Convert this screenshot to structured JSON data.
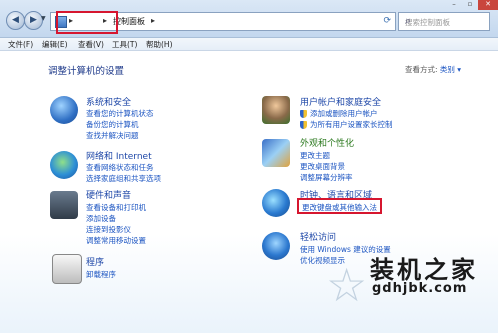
{
  "address": {
    "crumb": "控制面板",
    "search_placeholder": "搜索控制面板"
  },
  "menu": [
    "文件(F)",
    "编辑(E)",
    "查看(V)",
    "工具(T)",
    "帮助(H)"
  ],
  "page": {
    "title": "调整计算机的设置",
    "view_by_label": "查看方式:",
    "view_by_value": "类别 ▾"
  },
  "categories": {
    "system": {
      "title": "系统和安全",
      "links": [
        "查看您的计算机状态",
        "备份您的计算机",
        "查找并解决问题"
      ]
    },
    "network": {
      "title": "网络和 Internet",
      "links": [
        "查看网络状态和任务",
        "选择家庭组和共享选项"
      ]
    },
    "hardware": {
      "title": "硬件和声音",
      "links": [
        "查看设备和打印机",
        "添加设备",
        "连接到投影仪",
        "调整常用移动设置"
      ]
    },
    "programs": {
      "title": "程序",
      "links": [
        "卸载程序"
      ]
    },
    "users": {
      "title": "用户帐户和家庭安全",
      "links": [
        "添加或删除用户帐户",
        "为所有用户设置家长控制"
      ]
    },
    "appearance": {
      "title": "外观和个性化",
      "links": [
        "更改主题",
        "更改桌面背景",
        "调整屏幕分辨率"
      ]
    },
    "clock": {
      "title": "时钟、语言和区域",
      "links": [
        "更改键盘或其他输入法"
      ]
    },
    "access": {
      "title": "轻松访问",
      "links": [
        "使用 Windows 建议的设置",
        "优化视频显示"
      ]
    }
  },
  "watermark": {
    "main": "装机之家",
    "url": "gdhjbk.com"
  },
  "colors": {
    "highlight": "#d6162f",
    "link": "#1c55c2",
    "category": "#1f48a8"
  }
}
